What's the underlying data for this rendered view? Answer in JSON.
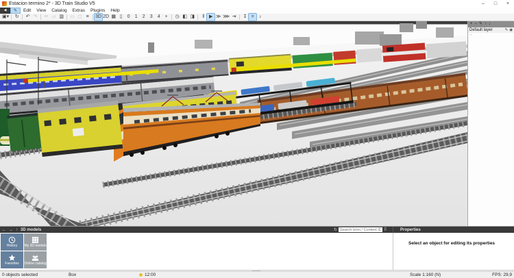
{
  "window": {
    "title": "Estacion termino 2* - 3D Train Studio V5",
    "controls": {
      "minimize": "–",
      "maximize": "□",
      "close": "×"
    }
  },
  "menubar": {
    "back_glyph": "◀",
    "pencil_glyph": "✎",
    "items": [
      "Edit",
      "View",
      "Catalog",
      "Extras",
      "Plugins",
      "Help"
    ]
  },
  "toolbar": {
    "buttons": [
      {
        "name": "save",
        "glyph": "▣▾"
      },
      {
        "sep": true
      },
      {
        "name": "reset-camera",
        "glyph": "↻"
      },
      {
        "sep": true
      },
      {
        "name": "undo",
        "glyph": "↶"
      },
      {
        "name": "redo",
        "glyph": "↷",
        "state": "dim"
      },
      {
        "sep": true
      },
      {
        "name": "cut",
        "glyph": "✂",
        "state": "dim"
      },
      {
        "name": "copy",
        "glyph": "▱",
        "state": "dim"
      },
      {
        "name": "paste",
        "glyph": "▥"
      },
      {
        "sep": true
      },
      {
        "name": "group",
        "glyph": "▭",
        "state": "dim"
      },
      {
        "name": "ungroup",
        "glyph": "◻",
        "state": "dim"
      },
      {
        "name": "object-list",
        "glyph": "≡"
      },
      {
        "sep": true
      },
      {
        "name": "view-3d",
        "glyph": "3D",
        "state": "active"
      },
      {
        "name": "view-2d",
        "glyph": "2D"
      },
      {
        "name": "grid",
        "glyph": "▦"
      },
      {
        "name": "layer-height",
        "glyph": "▯"
      },
      {
        "name": "camera-0",
        "glyph": "0"
      },
      {
        "name": "camera-1",
        "glyph": "1"
      },
      {
        "name": "camera-2",
        "glyph": "2"
      },
      {
        "name": "camera-3",
        "glyph": "3"
      },
      {
        "name": "camera-4",
        "glyph": "4"
      },
      {
        "name": "camera-add",
        "glyph": "+"
      },
      {
        "sep": true
      },
      {
        "name": "event-timer",
        "glyph": "◷"
      },
      {
        "name": "view-manager",
        "glyph": "◧"
      },
      {
        "name": "camera-view",
        "glyph": "◨"
      },
      {
        "sep": true
      },
      {
        "name": "pause",
        "glyph": "‖"
      },
      {
        "name": "play",
        "glyph": "▶",
        "state": "active"
      },
      {
        "name": "fast-forward",
        "glyph": "≫"
      },
      {
        "name": "faster-forward",
        "glyph": "⋙"
      },
      {
        "name": "skip-end",
        "glyph": "⇥"
      },
      {
        "sep": true
      },
      {
        "name": "import",
        "glyph": "↧"
      },
      {
        "name": "speed-toggle",
        "glyph": "=",
        "state": "active"
      },
      {
        "name": "volume",
        "glyph": "♪"
      }
    ]
  },
  "layers_panel": {
    "buttons": [
      {
        "name": "add-layer",
        "glyph": "+"
      },
      {
        "name": "remove-layer",
        "glyph": "−"
      },
      {
        "name": "edit-layer",
        "glyph": "✎"
      },
      {
        "name": "move-layer-up",
        "glyph": "↑"
      },
      {
        "name": "move-layer-down",
        "glyph": "↓"
      }
    ],
    "item": {
      "label": "Default layer",
      "edit_glyph": "✎",
      "visible_glyph": "◉",
      "sub": "-"
    }
  },
  "bottom": {
    "nav": {
      "back": "←",
      "forward": "→",
      "up": "↑",
      "title": "3D models"
    },
    "search": {
      "refresh": "↻",
      "placeholder": "Search term / Content ID",
      "grid_toggle": "⠿"
    },
    "tiles": [
      {
        "label": "History",
        "icon": "clock",
        "color": "#64809e"
      },
      {
        "label": "My 3D models",
        "icon": "grid",
        "color": "#9aa0a4"
      },
      {
        "label": "Favorites",
        "icon": "star",
        "color": "#64809e"
      },
      {
        "label": "Online catalog",
        "icon": "people",
        "color": "#9aa0a4"
      }
    ],
    "properties": {
      "title": "Properties",
      "empty_text": "Select an object for editing its properties"
    }
  },
  "statusbar": {
    "selection": "0 objects selected",
    "tool": "Box",
    "time": "12:00",
    "scale": "Scale 1:160 (N)",
    "fps": "FPS: 29,9",
    "sun_color": "#e8c12c"
  },
  "colors": {
    "accent_active": "#c6e0f5",
    "panel_dark": "#3a3a3a",
    "loco_orange": "#d87a1f",
    "tile_blue": "#64809e",
    "tile_gray": "#9aa0a4"
  }
}
